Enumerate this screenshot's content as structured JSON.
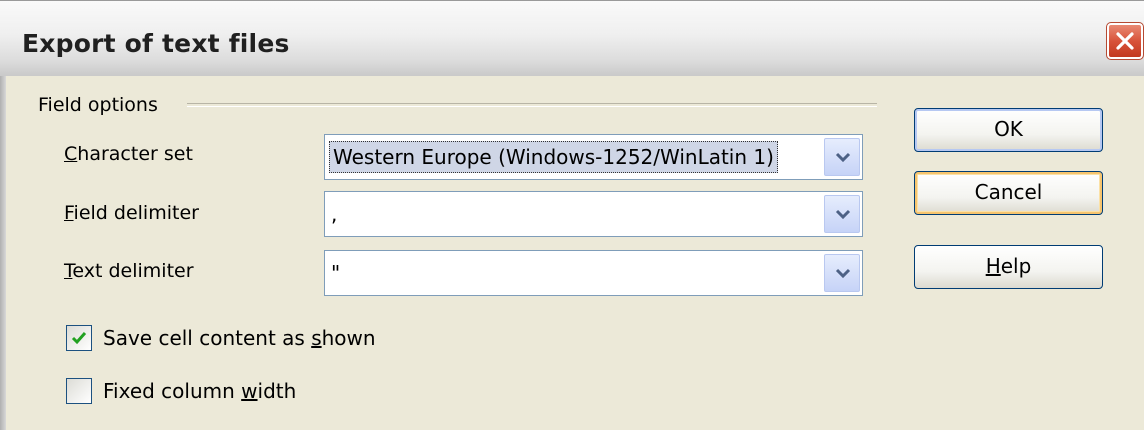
{
  "dialog": {
    "title": "Export of text files",
    "group_label": "Field options"
  },
  "fields": {
    "character_set": {
      "label_underlined": "C",
      "label_rest": "haracter set",
      "value": "Western Europe (Windows-1252/WinLatin 1)"
    },
    "field_delimiter": {
      "label_underlined": "F",
      "label_rest": "ield delimiter",
      "value": ","
    },
    "text_delimiter": {
      "label_underlined": "T",
      "label_rest": "ext delimiter",
      "value": "\""
    }
  },
  "options": {
    "save_as_shown": {
      "label_pre": "Save cell content as ",
      "label_underlined": "s",
      "label_post": "hown",
      "checked": true
    },
    "fixed_width": {
      "label_pre": "Fixed column ",
      "label_underlined": "w",
      "label_post": "idth",
      "checked": false
    }
  },
  "buttons": {
    "ok": "OK",
    "cancel": "Cancel",
    "help_underlined": "H",
    "help_rest": "elp"
  },
  "icons": {
    "close": "close-icon",
    "dropdown": "chevron-down-icon",
    "check": "checkmark-icon"
  },
  "colors": {
    "close_button": "#d8533a",
    "check_mark": "#21a121",
    "dialog_bg": "#ece9d8"
  }
}
